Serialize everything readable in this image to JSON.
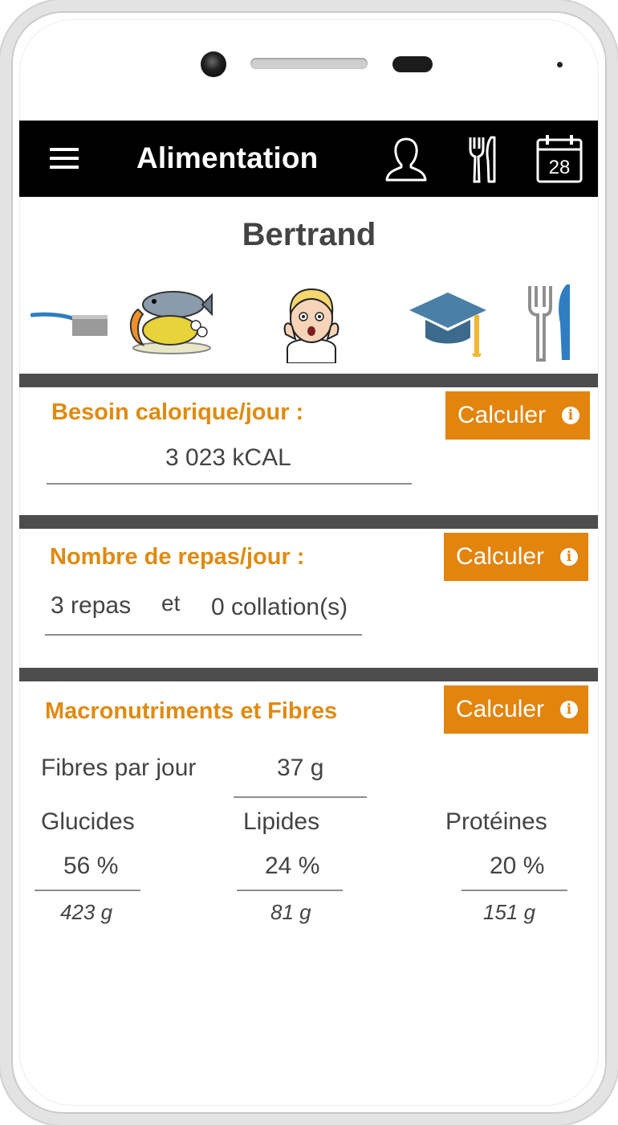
{
  "app": {
    "title": "Alimentation"
  },
  "header_icons": [
    "user-profile-icon",
    "fork-knife-icon",
    "calendar-icon"
  ],
  "calendar_day": "28",
  "user": {
    "name": "Bertrand"
  },
  "strip_icons": [
    "frying-pan-icon",
    "food-platter-icon",
    "worried-avatar-icon",
    "graduation-cap-icon",
    "cutlery-icon"
  ],
  "calorie": {
    "title": "Besoin calorique/jour :",
    "value": "3 023 kCAL",
    "button": "Calculer"
  },
  "meals": {
    "title": "Nombre de repas/jour :",
    "repas": "3 repas",
    "et": "et",
    "collations": "0 collation(s)",
    "button": "Calculer"
  },
  "macros": {
    "title": "Macronutriments et Fibres",
    "button": "Calculer",
    "fibres_label": "Fibres par jour",
    "fibres_value": "37 g",
    "items": [
      {
        "label": "Glucides",
        "percent": "56 %",
        "grams": "423 g"
      },
      {
        "label": "Lipides",
        "percent": "24 %",
        "grams": "81 g"
      },
      {
        "label": "Protéines",
        "percent": "20 %",
        "grams": "151 g"
      }
    ]
  },
  "colors": {
    "accent": "#e3840c",
    "title_orange": "#e08a10",
    "appbar": "#000000",
    "separator": "#4d4d4d",
    "text": "#444444"
  }
}
